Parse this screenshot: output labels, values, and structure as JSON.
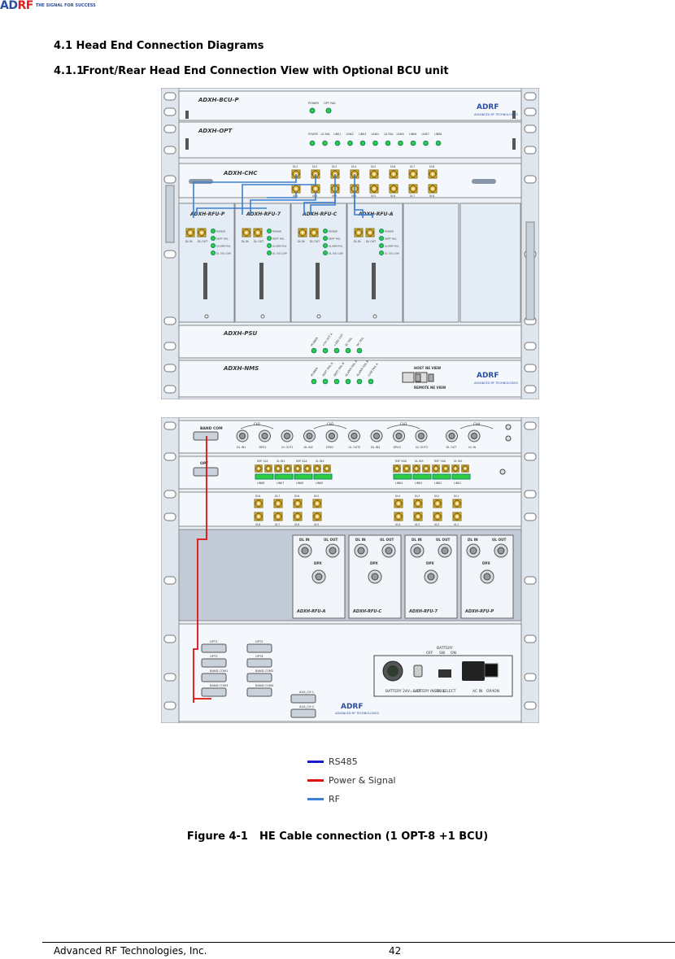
{
  "header": {
    "logo_text": "ADRF",
    "tagline": "THE SIGNAL FOR SUCCESS"
  },
  "section": {
    "title": "4.1  Head End Connection Diagrams"
  },
  "subsection": {
    "number": "4.1.1",
    "title": "Front/Rear Head End Connection View with Optional BCU unit"
  },
  "front": {
    "bcu_label": "ADXH-BCU-P",
    "opt_label": "ADXH-OPT",
    "chc_label": "ADXH-CHC",
    "psu_label": "ADXH-PSU",
    "nms_label": "ADXH-NMS",
    "bcu_leds": [
      "POWER",
      "OPT FAIL"
    ],
    "opt_leds": [
      "POWER",
      "LD FAIL",
      "LINK1",
      "LINK2",
      "LINK3",
      "LINK4",
      "LD FAIL",
      "LINK5",
      "LINK6",
      "LINK7",
      "LINK8"
    ],
    "chc_ports_top": [
      "DL1",
      "DL2",
      "DL3",
      "DL4",
      "DL5",
      "DL6",
      "DL7",
      "DL8"
    ],
    "chc_ports_bottom": [
      "UL1",
      "UL2",
      "UL3",
      "UL4",
      "UL5",
      "UL6",
      "UL7",
      "UL8"
    ],
    "rfu_modules": [
      "ADXH-RFU-P",
      "ADXH-RFU-7",
      "ADXH-RFU-C",
      "ADXH-RFU-A"
    ],
    "rfu_ports": [
      "DL IN",
      "DL OUT"
    ],
    "rfu_leds": [
      "POWER",
      "DEPT FAIL",
      "ALARM FAIL",
      "DL SIG LOW"
    ],
    "psu_leds": [
      "POWER",
      "+5V OUT A",
      "+28V OUT",
      "AC FAIL",
      "DC FAIL"
    ],
    "nms_leds": [
      "POWER",
      "DEPT FAIL A",
      "DEPT FAIL B",
      "ALARM FAIL A",
      "ALARM FAIL B",
      "LOW FAIL A"
    ],
    "nms_ports": [
      "HOST",
      "NE VIEW",
      "REMOTE NE VIEW"
    ],
    "brand": "ADRF",
    "brand_sub": "ADVANCED RF TECHNOLOGIES"
  },
  "rear": {
    "band_com": "BAND COM",
    "opt": "OPT",
    "ch_labels": [
      "CH1",
      "CH2",
      "CH3",
      "CH4"
    ],
    "bcu_ports": [
      "DL IN1",
      "DPX1",
      "UL OUT1",
      "DL IN2",
      "DPX2",
      "UL OUT2",
      "DL IN3",
      "DPX3",
      "UL OUT3",
      "DL OUT",
      "UL IN"
    ],
    "opt_ports": [
      "RSP 1&2",
      "UL IN1",
      "RSP 3&4",
      "UL IN2",
      "RSP 5&6",
      "UL IN3",
      "RSP 7&8",
      "UL IN4"
    ],
    "opt_link": [
      "LINK8",
      "LINK7",
      "LINK6",
      "LINK5",
      "LINK4",
      "LINK3",
      "LINK2",
      "LINK1"
    ],
    "chc_top": [
      "DL8",
      "DL7",
      "DL6",
      "DL5",
      "DL4",
      "DL3",
      "DL2",
      "DL1"
    ],
    "chc_bottom": [
      "UL8",
      "UL7",
      "UL6",
      "UL5",
      "UL4",
      "UL3",
      "UL2",
      "UL1"
    ],
    "rfu_ports": [
      "DL IN",
      "UL OUT"
    ],
    "dpx": "DPX",
    "rfu_modules": [
      "ADXH-RFU-A",
      "ADXH-RFU-C",
      "ADXH-RFU-7",
      "ADXH-RFU-P"
    ],
    "psu_ports": [
      "OPT1",
      "OPT2",
      "OPT3",
      "OPT4",
      "BAND COM1",
      "BAND COM2",
      "BAND COM3",
      "BAND COM4",
      "AUX_CH 1",
      "AUX_CH 2"
    ],
    "battery_switch": [
      "BATTERY",
      "OFF",
      "SW",
      "ON"
    ],
    "battery_labels": [
      "BATTERY 24V==5A",
      "BATTERY INSTALL",
      "AC SELECT",
      "AC IN",
      "OP/ION"
    ]
  },
  "legend": [
    {
      "label": "RS485",
      "color": "#1a1acc"
    },
    {
      "label": "Power & Signal",
      "color": "#e01010"
    },
    {
      "label": "RF",
      "color": "#3d7fd0"
    }
  ],
  "figure": {
    "label": "Figure 4-1",
    "title": "HE Cable connection (1 OPT-8 +1 BCU)"
  },
  "footer": {
    "company": "Advanced RF Technologies, Inc.",
    "page": "42"
  }
}
